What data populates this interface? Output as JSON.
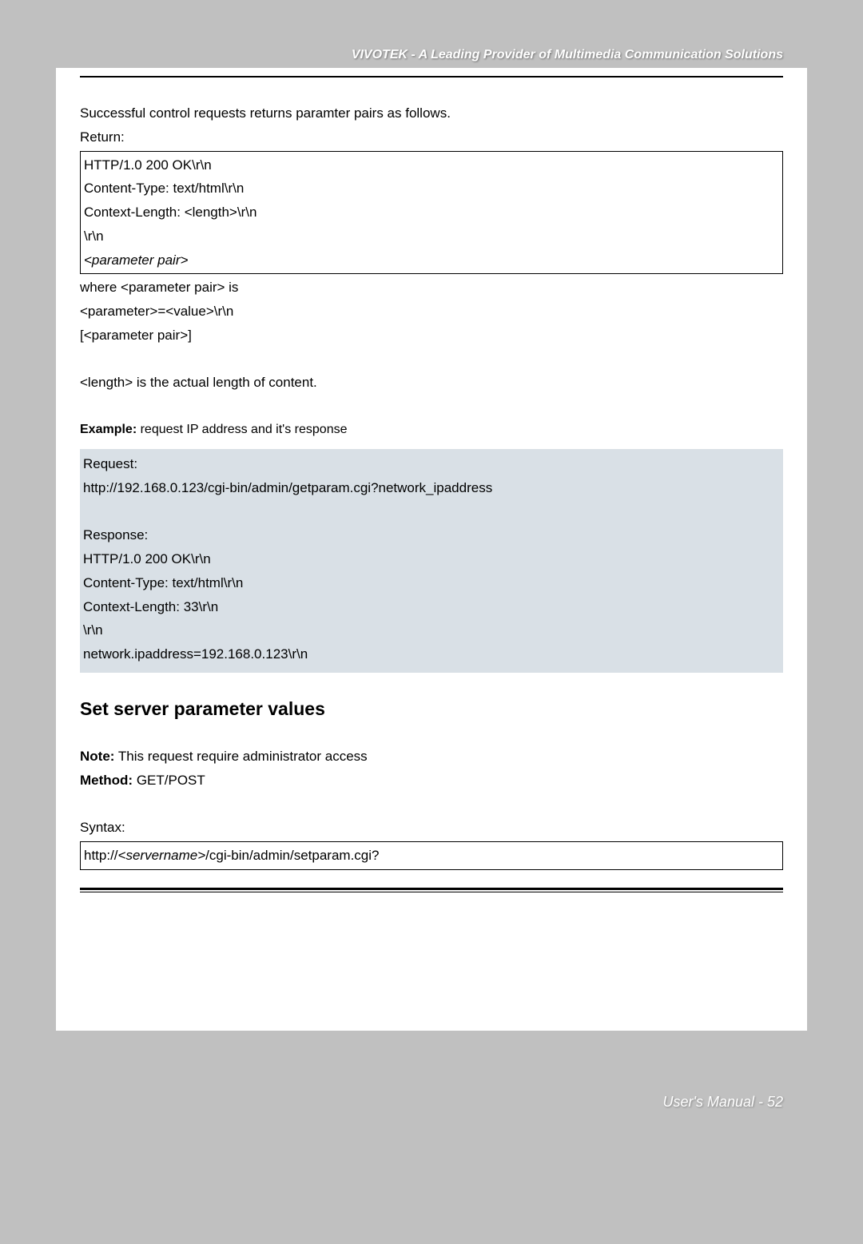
{
  "header": {
    "brand_line": "VIVOTEK - A Leading Provider of Multimedia Communication Solutions"
  },
  "section1": {
    "intro": "Successful control requests returns paramter pairs as follows.",
    "return_label": "Return:",
    "box": {
      "l1": "HTTP/1.0 200 OK\\r\\n",
      "l2": "Content-Type: text/html\\r\\n",
      "l3": "Context-Length: <length>\\r\\n",
      "l4": "\\r\\n",
      "l5": "<parameter pair>"
    },
    "after1": "where <parameter pair> is",
    "after2": "<parameter>=<value>\\r\\n",
    "after3": "[<parameter pair>]",
    "length_note": "<length> is the actual length of content."
  },
  "example": {
    "label_bold": "Example:",
    "label_rest": " request IP address and it's response",
    "req_label": "Request:",
    "req_url": "http://192.168.0.123/cgi-bin/admin/getparam.cgi?network_ipaddress",
    "res_label": "Response:",
    "r1": "HTTP/1.0 200 OK\\r\\n",
    "r2": "Content-Type: text/html\\r\\n",
    "r3": "Context-Length: 33\\r\\n",
    "r4": "\\r\\n",
    "r5": "network.ipaddress=192.168.0.123\\r\\n"
  },
  "section2": {
    "heading": "Set server parameter values",
    "note_bold": "Note:",
    "note_rest": " This request require administrator access",
    "method_bold": "Method:",
    "method_rest": " GET/POST",
    "syntax_label": "Syntax:",
    "syntax_pre": "http://",
    "syntax_italic": "<servername>",
    "syntax_post": "/cgi-bin/admin/setparam.cgi?"
  },
  "footer": {
    "label": "User's Manual - 52"
  }
}
